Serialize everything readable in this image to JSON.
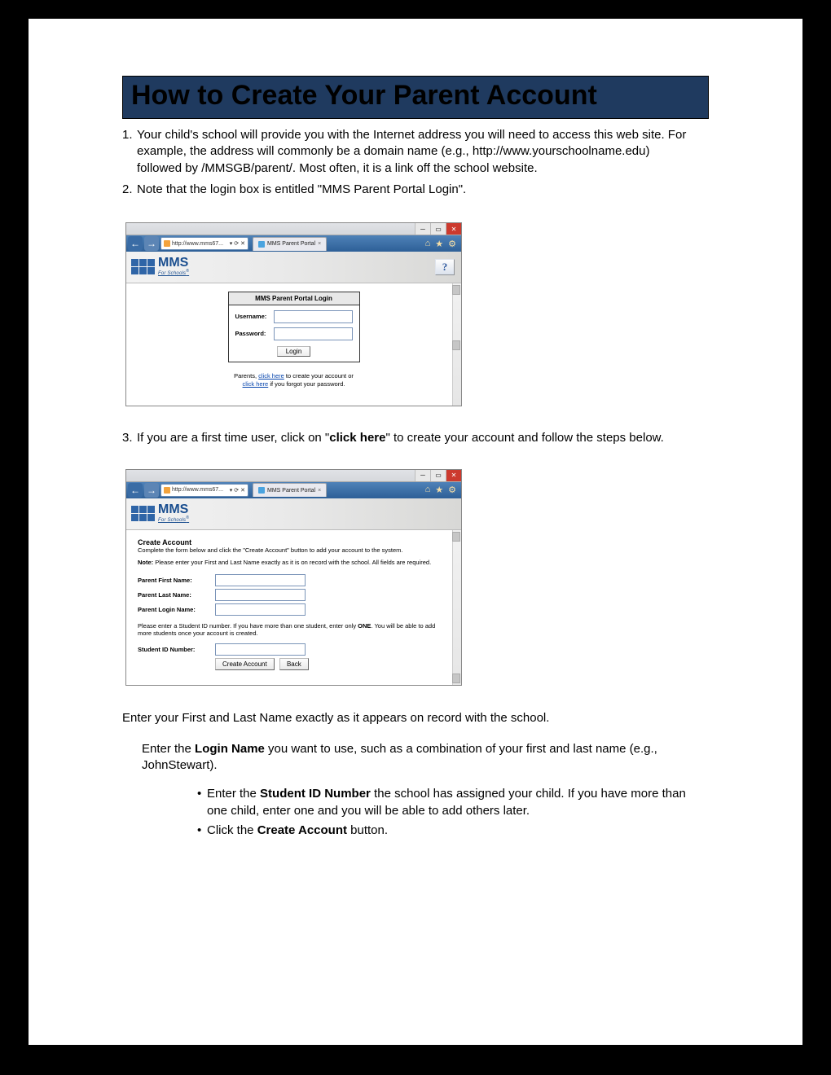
{
  "title": "How to Create Your Parent Account",
  "steps": {
    "one": "Your child's school will provide you with the Internet address you will need to access this web site. For example, the address will commonly be a domain name (e.g., http://www.yourschoolname.edu) followed by /MMSGB/parent/.  Most often, it is a link off the school website.",
    "two": "Note that the login box is entitled \"MMS Parent Portal Login\".",
    "three_pre": "If you are a first time user, click on \"",
    "three_bold": "click here",
    "three_post": "\" to create your account and follow the steps below."
  },
  "browser": {
    "address": "http://www.mms67...",
    "refresh": "⟳",
    "close": "✕",
    "tab_title": "MMS Parent Portal",
    "icons": {
      "home": "⌂",
      "star": "★",
      "gear": "⚙"
    }
  },
  "portal": {
    "logo_main": "MMS",
    "logo_sub": "For Schools",
    "help": "?",
    "login": {
      "title": "MMS Parent Portal Login",
      "username": "Username:",
      "password": "Password:",
      "submit": "Login",
      "links_pre": "Parents, ",
      "link1": "click here",
      "links_mid": " to create your account or ",
      "link2": "click here",
      "links_post": " if you forgot your password."
    },
    "create": {
      "heading": "Create Account",
      "sub": "Complete the form below and click the \"Create Account\" button to add your account to the system.",
      "note_label": "Note:",
      "note_text": " Please enter your First and Last Name exactly as it is on record with the school. All fields are required.",
      "f_first": "Parent First Name:",
      "f_last": "Parent Last Name:",
      "f_login": "Parent Login Name:",
      "instr_pre": "Please enter a Student ID number. If you have more than one student, enter only ",
      "instr_bold": "ONE",
      "instr_post": ". You will be able to add more students once your account is created.",
      "f_sid": "Student ID Number:",
      "btn_create": "Create Account",
      "btn_back": "Back"
    }
  },
  "body": {
    "p1": "Enter your First and Last Name exactly as it appears on record with the school.",
    "p2_pre": "Enter the ",
    "p2_b": "Login Name",
    "p2_post": " you want to use, such as a combination of your first and last name (e.g., JohnStewart).",
    "b1_pre": "Enter the ",
    "b1_b": "Student ID Number",
    "b1_post": " the school has assigned your child. If you have more than one child, enter one and you will be able to add others later.",
    "b2_pre": "Click the ",
    "b2_b": "Create Account",
    "b2_post": " button."
  }
}
